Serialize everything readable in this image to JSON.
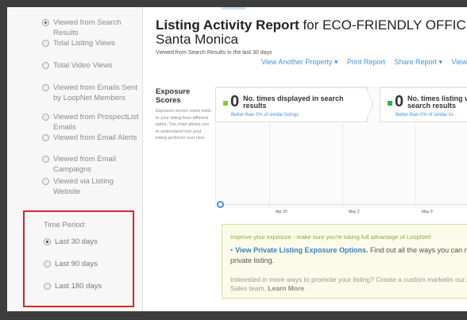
{
  "sidebar": {
    "view_options": [
      {
        "label": "Viewed from Search Results",
        "selected": true
      },
      {
        "label": "Total Listing Views",
        "selected": false
      },
      {
        "label": "Total Video Views",
        "selected": false
      },
      {
        "label": "Viewed from Emails Sent by LoopNet Members",
        "selected": false
      },
      {
        "label": "Viewed from ProspectList Emails",
        "selected": false
      },
      {
        "label": "Viewed from Email Alerts",
        "selected": false
      },
      {
        "label": "Viewed from Email Campaigns",
        "selected": false
      },
      {
        "label": "Viewed via Listing Website",
        "selected": false
      }
    ],
    "time_period": {
      "title": "Time Period:",
      "options": [
        {
          "label": "Last 30 days",
          "selected": true
        },
        {
          "label": "Last 90 days",
          "selected": false
        },
        {
          "label": "Last 180 days",
          "selected": false
        }
      ]
    }
  },
  "header": {
    "title_bold": "Listing Activity Report",
    "title_rest": " for ECO-FRIENDLY OFFICE - D",
    "title_line2": "Santa Monica",
    "subtitle": "Viewed from Search Results in the last 30 days"
  },
  "actions": {
    "view_another": "View Another Property ▾",
    "print": "Print Report",
    "share": "Share Report ▾",
    "view": "View"
  },
  "exposure": {
    "title": "Exposure Scores",
    "description": "Exposure scores count visits to your listing from different paths. The chart allows you to understand how your listing performs over time.",
    "metrics": [
      {
        "value": "0",
        "label": "No. times displayed in search results",
        "sub": "Better than 0% of similar listings",
        "color": "#8cc63f"
      },
      {
        "value": "0",
        "label": "No. times listing v search results",
        "sub": "Better than 0% of similar lis",
        "color": "#2eb34a"
      }
    ]
  },
  "chart_data": {
    "type": "line",
    "x": [
      "Apr 25",
      "May 2",
      "May 9"
    ],
    "series": [
      {
        "values": [
          0,
          0,
          0
        ]
      }
    ]
  },
  "promo": {
    "headline": "Improve your exposure - make sure you're taking full advantage of LoopNet!",
    "link": "View Private Listing Exposure Options.",
    "body": " Find out all the ways you can m private listing.",
    "footer_text": "Interested in more ways to promote your listing? Create a custom marketin our Ad Sales team.",
    "footer_link": "Learn More"
  }
}
